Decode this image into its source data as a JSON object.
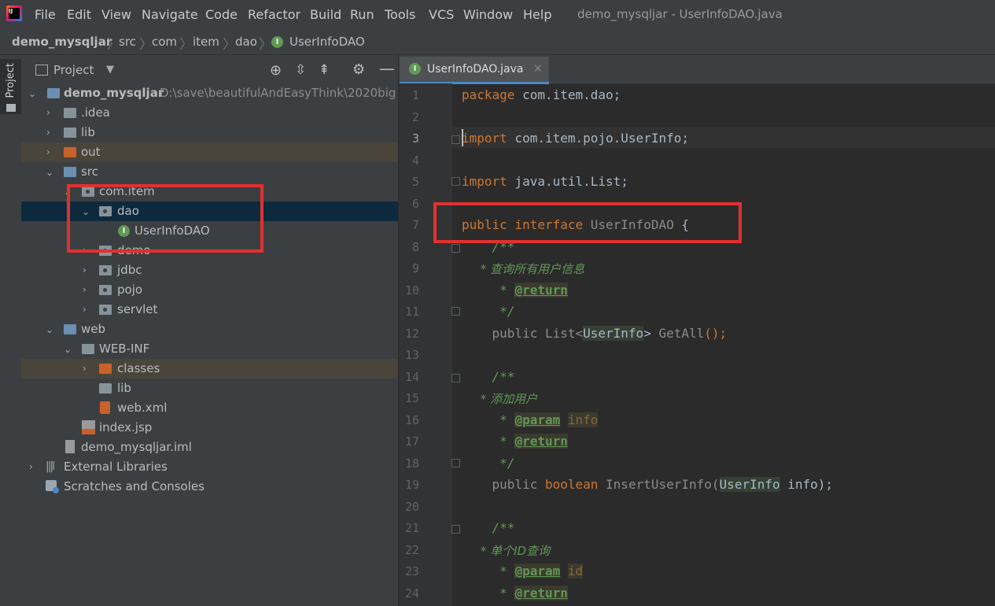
{
  "menubar": {
    "items": [
      "File",
      "Edit",
      "View",
      "Navigate",
      "Code",
      "Refactor",
      "Build",
      "Run",
      "Tools",
      "VCS",
      "Window",
      "Help"
    ],
    "window_title": "demo_mysqljar - UserInfoDAO.java"
  },
  "breadcrumb": [
    "demo_mysqljar",
    "src",
    "com",
    "item",
    "dao",
    "UserInfoDAO"
  ],
  "side_strip": {
    "label": "Project"
  },
  "project_panel": {
    "title": "Project",
    "root": {
      "name": "demo_mysqljar",
      "path": "D:\\save\\beautifulAndEasyThink\\2020bigda"
    },
    "tree": [
      {
        "label": ".idea"
      },
      {
        "label": "lib"
      },
      {
        "label": "out"
      },
      {
        "label": "src"
      },
      {
        "label": "com.item"
      },
      {
        "label": "dao"
      },
      {
        "label": "UserInfoDAO"
      },
      {
        "label": "demo"
      },
      {
        "label": "jdbc"
      },
      {
        "label": "pojo"
      },
      {
        "label": "servlet"
      },
      {
        "label": "web"
      },
      {
        "label": "WEB-INF"
      },
      {
        "label": "classes"
      },
      {
        "label": "lib"
      },
      {
        "label": "web.xml"
      },
      {
        "label": "index.jsp"
      },
      {
        "label": "demo_mysqljar.iml"
      },
      {
        "label": "External Libraries"
      },
      {
        "label": "Scratches and Consoles"
      }
    ]
  },
  "editor": {
    "tab_label": "UserInfoDAO.java",
    "line_numbers": [
      "1",
      "2",
      "3",
      "4",
      "5",
      "6",
      "7",
      "8",
      "9",
      "10",
      "11",
      "12",
      "13",
      "14",
      "15",
      "16",
      "17",
      "18",
      "19",
      "20",
      "21",
      "22",
      "23",
      "24"
    ],
    "lines": {
      "l1a": "package",
      "l1b": " com.item.dao;",
      "l3a": "import",
      "l3b": " com.item.pojo.UserInfo;",
      "l5a": "import",
      "l5b": " java.util.List;",
      "l7a": "public",
      "l7b": " interface",
      "l7c": " UserInfoDAO",
      "l7d": " {",
      "l8": "    /**",
      "l9": "     * 查询所有用户信息",
      "l10a": "     * ",
      "l10b": "@return",
      "l11": "     */",
      "l12a": "    public List<",
      "l12b": "UserInfo",
      "l12c": "> ",
      "l12d": "GetAll",
      "l12e": "();",
      "l14": "    /**",
      "l15": "     * 添加用户",
      "l16a": "     * ",
      "l16b": "@param",
      "l16c": "info",
      "l17a": "     * ",
      "l17b": "@return",
      "l18": "     */",
      "l19a": "    public ",
      "l19b": "boolean",
      "l19c": " InsertUserInfo",
      "l19d": "(",
      "l19e": "UserInfo",
      "l19f": " info);",
      "l21": "    /**",
      "l22": "     * 单个ID查询",
      "l23a": "     * ",
      "l23b": "@param",
      "l23c": "id",
      "l24a": "     * ",
      "l24b": "@return"
    }
  }
}
